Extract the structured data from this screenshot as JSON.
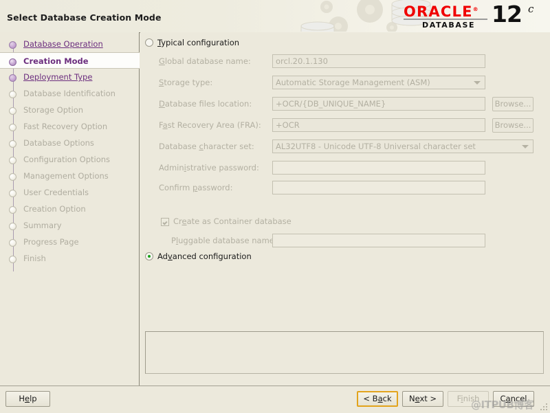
{
  "header": {
    "title": "Select Database Creation Mode",
    "logo": {
      "oracle": "ORACLE",
      "registered": "®",
      "database": "DATABASE",
      "version": "12",
      "edition": "c"
    }
  },
  "sidebar": {
    "items": [
      {
        "label": "Database Operation",
        "state": "done"
      },
      {
        "label": "Creation Mode",
        "state": "current"
      },
      {
        "label": "Deployment Type",
        "state": "done"
      },
      {
        "label": "Database Identification",
        "state": "todo"
      },
      {
        "label": "Storage Option",
        "state": "todo"
      },
      {
        "label": "Fast Recovery Option",
        "state": "todo"
      },
      {
        "label": "Database Options",
        "state": "todo"
      },
      {
        "label": "Configuration Options",
        "state": "todo"
      },
      {
        "label": "Management Options",
        "state": "todo"
      },
      {
        "label": "User Credentials",
        "state": "todo"
      },
      {
        "label": "Creation Option",
        "state": "todo"
      },
      {
        "label": "Summary",
        "state": "todo"
      },
      {
        "label": "Progress Page",
        "state": "todo"
      },
      {
        "label": "Finish",
        "state": "todo"
      }
    ]
  },
  "main": {
    "typical": {
      "label_pre": "",
      "label_mn": "T",
      "label_post": "ypical configuration",
      "selected": false
    },
    "fields": {
      "global_db_name": {
        "label_pre": "",
        "label_mn": "G",
        "label_post": "lobal database name:",
        "value": "orcl.20.1.130"
      },
      "storage_type": {
        "label_pre": "",
        "label_mn": "S",
        "label_post": "torage type:",
        "value": "Automatic Storage Management (ASM)"
      },
      "db_files_location": {
        "label_pre": "",
        "label_mn": "D",
        "label_post": "atabase files location:",
        "value": "+OCR/{DB_UNIQUE_NAME}",
        "browse": "Browse..."
      },
      "fra": {
        "label_pre": "F",
        "label_mn": "a",
        "label_post": "st Recovery Area (FRA):",
        "value": "+OCR",
        "browse": "Browse..."
      },
      "charset": {
        "label_pre": "Database ",
        "label_mn": "c",
        "label_post": "haracter set:",
        "value": "AL32UTF8 - Unicode UTF-8 Universal character set"
      },
      "admin_password": {
        "label_pre": "Admin",
        "label_mn": "i",
        "label_post": "strative password:",
        "value": ""
      },
      "confirm_password": {
        "label_pre": "Confirm ",
        "label_mn": "p",
        "label_post": "assword:",
        "value": ""
      },
      "pluggable_db_name": {
        "label_pre": "P",
        "label_mn": "l",
        "label_post": "uggable database name:",
        "value": ""
      }
    },
    "container_checkbox": {
      "label_pre": "Cr",
      "label_mn": "e",
      "label_post": "ate as Container database",
      "checked": true
    },
    "advanced": {
      "label_pre": "Ad",
      "label_mn": "v",
      "label_post": "anced configuration",
      "selected": true
    }
  },
  "footer": {
    "help": {
      "pre": "H",
      "mn": "e",
      "post": "lp"
    },
    "back": {
      "pre": "< B",
      "mn": "a",
      "post": "ck"
    },
    "next": {
      "pre": "N",
      "mn": "e",
      "post": "xt >"
    },
    "finish": {
      "pre": "F",
      "mn": "i",
      "post": "nish"
    },
    "cancel": {
      "pre": "C",
      "mn": "a",
      "post": "ncel"
    },
    "watermark": "@ITPUB博客"
  },
  "colors": {
    "background": "#ece9dc",
    "accent_purple": "#6b2d7e",
    "oracle_red": "#f00000",
    "focus_orange": "#e2a31c",
    "radio_green": "#19a019"
  }
}
